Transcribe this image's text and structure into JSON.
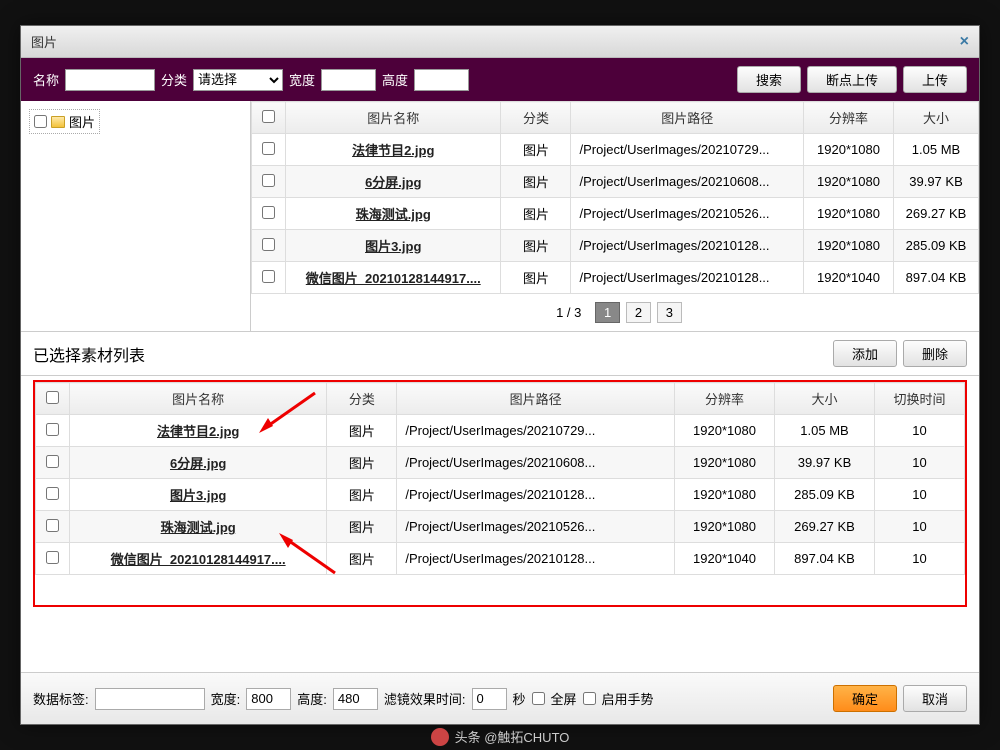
{
  "dialog": {
    "title": "图片",
    "close": "×"
  },
  "filter": {
    "name_label": "名称",
    "category_label": "分类",
    "category_placeholder": "请选择",
    "width_label": "宽度",
    "height_label": "高度",
    "search_btn": "搜索",
    "resume_upload_btn": "断点上传",
    "upload_btn": "上传"
  },
  "tree": {
    "root": "图片"
  },
  "grid": {
    "headers": {
      "name": "图片名称",
      "category": "分类",
      "path": "图片路径",
      "resolution": "分辨率",
      "size": "大小"
    },
    "rows": [
      {
        "name": "法律节目2.jpg",
        "category": "图片",
        "path": "/Project/UserImages/20210729...",
        "resolution": "1920*1080",
        "size": "1.05 MB"
      },
      {
        "name": "6分屏.jpg",
        "category": "图片",
        "path": "/Project/UserImages/20210608...",
        "resolution": "1920*1080",
        "size": "39.97 KB"
      },
      {
        "name": "珠海测试.jpg",
        "category": "图片",
        "path": "/Project/UserImages/20210526...",
        "resolution": "1920*1080",
        "size": "269.27 KB"
      },
      {
        "name": "图片3.jpg",
        "category": "图片",
        "path": "/Project/UserImages/20210128...",
        "resolution": "1920*1080",
        "size": "285.09 KB"
      },
      {
        "name": "微信图片_20210128144917....",
        "category": "图片",
        "path": "/Project/UserImages/20210128...",
        "resolution": "1920*1040",
        "size": "897.04 KB"
      }
    ],
    "pager": {
      "info": "1 / 3",
      "pages": [
        "1",
        "2",
        "3"
      ],
      "active": 0
    }
  },
  "selected": {
    "title": "已选择素材列表",
    "add_btn": "添加",
    "delete_btn": "删除",
    "headers": {
      "name": "图片名称",
      "category": "分类",
      "path": "图片路径",
      "resolution": "分辨率",
      "size": "大小",
      "switch": "切换时间"
    },
    "rows": [
      {
        "name": "法律节目2.jpg",
        "category": "图片",
        "path": "/Project/UserImages/20210729...",
        "resolution": "1920*1080",
        "size": "1.05 MB",
        "switch": "10"
      },
      {
        "name": "6分屏.jpg",
        "category": "图片",
        "path": "/Project/UserImages/20210608...",
        "resolution": "1920*1080",
        "size": "39.97 KB",
        "switch": "10"
      },
      {
        "name": "图片3.jpg",
        "category": "图片",
        "path": "/Project/UserImages/20210128...",
        "resolution": "1920*1080",
        "size": "285.09 KB",
        "switch": "10"
      },
      {
        "name": "珠海测试.jpg",
        "category": "图片",
        "path": "/Project/UserImages/20210526...",
        "resolution": "1920*1080",
        "size": "269.27 KB",
        "switch": "10"
      },
      {
        "name": "微信图片_20210128144917....",
        "category": "图片",
        "path": "/Project/UserImages/20210128...",
        "resolution": "1920*1040",
        "size": "897.04 KB",
        "switch": "10"
      }
    ]
  },
  "bottom": {
    "tag_label": "数据标签:",
    "width_label": "宽度:",
    "width_value": "800",
    "height_label": "高度:",
    "height_value": "480",
    "filter_time_label": "滤镜效果时间:",
    "filter_time_value": "0",
    "seconds": "秒",
    "fullscreen": "全屏",
    "gesture": "启用手势",
    "ok_btn": "确定",
    "cancel_btn": "取消"
  },
  "attribution": "头条 @触拓CHUTO"
}
